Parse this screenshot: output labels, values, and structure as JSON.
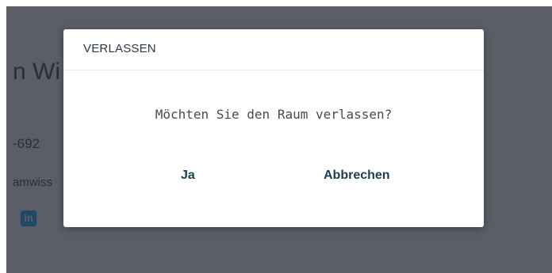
{
  "background": {
    "name_fragment": "n Wi",
    "phone_fragment": "-692",
    "email_fragment": "amwiss",
    "linkedin_icon_label": "in"
  },
  "dialog": {
    "title": "VERLASSEN",
    "message": "Möchten Sie den Raum verlassen?",
    "confirm_label": "Ja",
    "cancel_label": "Abbrechen"
  },
  "colors": {
    "overlay": "#5c5e67",
    "dialog_bg": "#ffffff",
    "button_text": "#1c3d4f",
    "title_text": "#2b3848"
  }
}
